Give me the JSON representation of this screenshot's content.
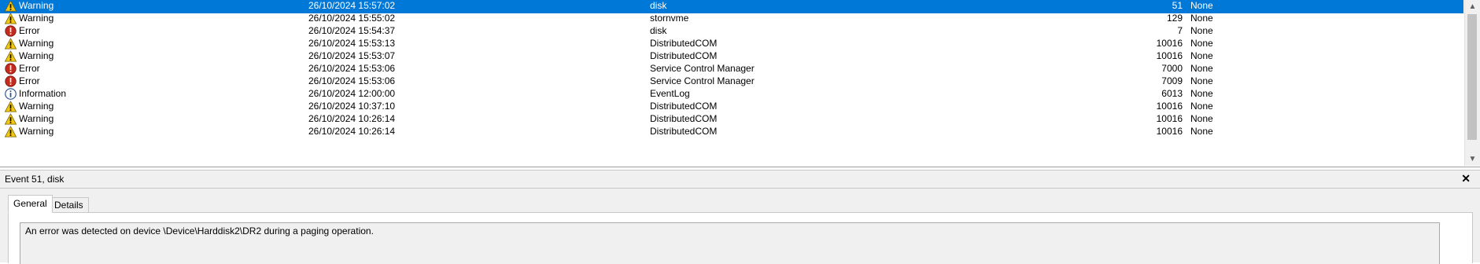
{
  "event_list": {
    "rows": [
      {
        "level": "Warning",
        "icon": "warning-icon",
        "datetime": "26/10/2024 15:57:02",
        "source": "disk",
        "event_id": "51",
        "task": "None",
        "selected": true
      },
      {
        "level": "Warning",
        "icon": "warning-icon",
        "datetime": "26/10/2024 15:55:02",
        "source": "stornvme",
        "event_id": "129",
        "task": "None",
        "selected": false
      },
      {
        "level": "Error",
        "icon": "error-icon",
        "datetime": "26/10/2024 15:54:37",
        "source": "disk",
        "event_id": "7",
        "task": "None",
        "selected": false
      },
      {
        "level": "Warning",
        "icon": "warning-icon",
        "datetime": "26/10/2024 15:53:13",
        "source": "DistributedCOM",
        "event_id": "10016",
        "task": "None",
        "selected": false
      },
      {
        "level": "Warning",
        "icon": "warning-icon",
        "datetime": "26/10/2024 15:53:07",
        "source": "DistributedCOM",
        "event_id": "10016",
        "task": "None",
        "selected": false
      },
      {
        "level": "Error",
        "icon": "error-icon",
        "datetime": "26/10/2024 15:53:06",
        "source": "Service Control Manager",
        "event_id": "7000",
        "task": "None",
        "selected": false
      },
      {
        "level": "Error",
        "icon": "error-icon",
        "datetime": "26/10/2024 15:53:06",
        "source": "Service Control Manager",
        "event_id": "7009",
        "task": "None",
        "selected": false
      },
      {
        "level": "Information",
        "icon": "information-icon",
        "datetime": "26/10/2024 12:00:00",
        "source": "EventLog",
        "event_id": "6013",
        "task": "None",
        "selected": false
      },
      {
        "level": "Warning",
        "icon": "warning-icon",
        "datetime": "26/10/2024 10:37:10",
        "source": "DistributedCOM",
        "event_id": "10016",
        "task": "None",
        "selected": false
      },
      {
        "level": "Warning",
        "icon": "warning-icon",
        "datetime": "26/10/2024 10:26:14",
        "source": "DistributedCOM",
        "event_id": "10016",
        "task": "None",
        "selected": false
      },
      {
        "level": "Warning",
        "icon": "warning-icon",
        "datetime": "26/10/2024 10:26:14",
        "source": "DistributedCOM",
        "event_id": "10016",
        "task": "None",
        "selected": false
      }
    ]
  },
  "scrollbar": {
    "up_icon": "scroll-up-arrow-icon",
    "down_icon": "scroll-down-arrow-icon"
  },
  "detail": {
    "title": "Event 51, disk",
    "close_icon": "close-icon",
    "tabs": [
      {
        "label": "General",
        "active": true
      },
      {
        "label": "Details",
        "active": false
      }
    ],
    "message": "An error was detected on device \\Device\\Harddisk2\\DR2 during a paging operation."
  },
  "colors": {
    "selection": "#0078d7",
    "warning": "#f2c811",
    "error": "#c42b1c",
    "information": "#1f4e99"
  }
}
